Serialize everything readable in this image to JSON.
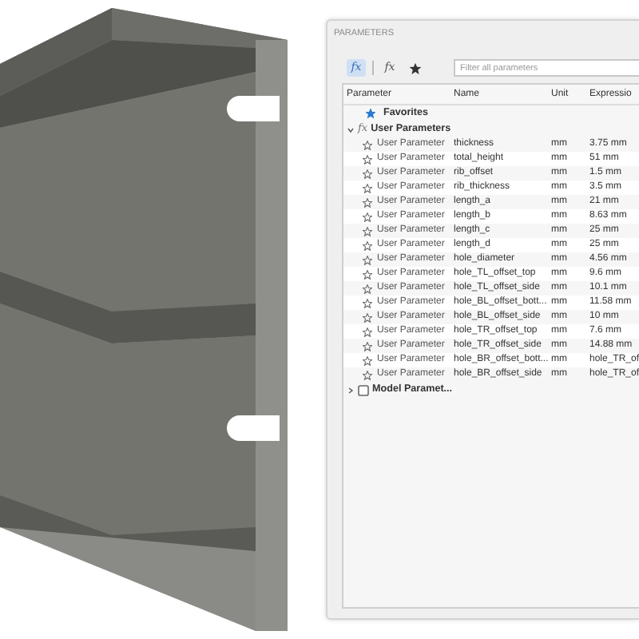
{
  "panel": {
    "title": "PARAMETERS"
  },
  "toolbar": [
    {
      "kind": "fx",
      "label": "fx",
      "selected": true
    },
    {
      "kind": "fx-sub",
      "label": "fx",
      "selected": false
    },
    {
      "kind": "star",
      "selected": false
    }
  ],
  "filter": {
    "placeholder": "Filter all parameters"
  },
  "table": {
    "columns": [
      "Parameter",
      "Name",
      "Unit",
      "Expressio"
    ],
    "tree": [
      {
        "kind": "favorites",
        "label": "Favorites"
      },
      {
        "kind": "group",
        "icon_text": "fx",
        "label": "User Parameters",
        "expanded": true,
        "children": [
          {
            "type": "User Parameter",
            "favorite": false,
            "name": "thickness",
            "unit": "mm",
            "expression": "3.75 mm"
          },
          {
            "type": "User Parameter",
            "favorite": false,
            "name": "total_height",
            "unit": "mm",
            "expression": "51 mm"
          },
          {
            "type": "User Parameter",
            "favorite": false,
            "name": "rib_offset",
            "unit": "mm",
            "expression": "1.5 mm"
          },
          {
            "type": "User Parameter",
            "favorite": false,
            "name": "rib_thickness",
            "unit": "mm",
            "expression": "3.5 mm"
          },
          {
            "type": "User Parameter",
            "favorite": false,
            "name": "length_a",
            "unit": "mm",
            "expression": "21 mm"
          },
          {
            "type": "User Parameter",
            "favorite": false,
            "name": "length_b",
            "unit": "mm",
            "expression": "8.63 mm"
          },
          {
            "type": "User Parameter",
            "favorite": false,
            "name": "length_c",
            "unit": "mm",
            "expression": "25 mm"
          },
          {
            "type": "User Parameter",
            "favorite": false,
            "name": "length_d",
            "unit": "mm",
            "expression": "25 mm"
          },
          {
            "type": "User Parameter",
            "favorite": false,
            "name": "hole_diameter",
            "unit": "mm",
            "expression": "4.56 mm"
          },
          {
            "type": "User Parameter",
            "favorite": false,
            "name": "hole_TL_offset_top",
            "unit": "mm",
            "expression": "9.6 mm"
          },
          {
            "type": "User Parameter",
            "favorite": false,
            "name": "hole_TL_offset_side",
            "unit": "mm",
            "expression": "10.1 mm"
          },
          {
            "type": "User Parameter",
            "favorite": false,
            "name": "hole_BL_offset_bott...",
            "unit": "mm",
            "expression": "11.58 mm"
          },
          {
            "type": "User Parameter",
            "favorite": false,
            "name": "hole_BL_offset_side",
            "unit": "mm",
            "expression": "10 mm"
          },
          {
            "type": "User Parameter",
            "favorite": false,
            "name": "hole_TR_offset_top",
            "unit": "mm",
            "expression": "7.6 mm"
          },
          {
            "type": "User Parameter",
            "favorite": false,
            "name": "hole_TR_offset_side",
            "unit": "mm",
            "expression": "14.88 mm"
          },
          {
            "type": "User Parameter",
            "favorite": false,
            "name": "hole_BR_offset_bott...",
            "unit": "mm",
            "expression": "hole_TR_of"
          },
          {
            "type": "User Parameter",
            "favorite": false,
            "name": "hole_BR_offset_side",
            "unit": "mm",
            "expression": "hole_TR_of"
          }
        ]
      },
      {
        "kind": "group",
        "label": "Model Paramet...",
        "expanded": false,
        "checked": false
      }
    ]
  }
}
